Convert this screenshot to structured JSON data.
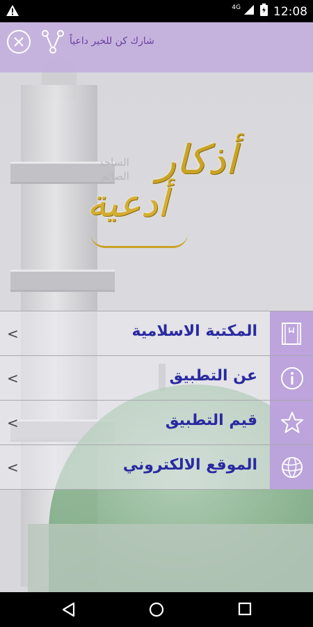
{
  "status_bar": {
    "network": "4G",
    "time": "12:08"
  },
  "header": {
    "share_text": "شارك كن للخير داعياً"
  },
  "logo": {
    "title_top": "أذكار",
    "title_bottom": "أدعية",
    "subtitle_line1": "الساجد",
    "subtitle_line2": "الصائم"
  },
  "menu": {
    "items": [
      {
        "label": "المكتبة الاسلامية",
        "icon": "book-icon"
      },
      {
        "label": "عن التطبيق",
        "icon": "info-icon"
      },
      {
        "label": "قيم التطبيق",
        "icon": "star-icon"
      },
      {
        "label": "الموقع الالكتروني",
        "icon": "globe-icon"
      }
    ]
  },
  "colors": {
    "header_bg": "#c4b0dc",
    "icon_box_bg": "#baa0dc",
    "menu_text": "#2a2aa0",
    "logo_gold": "#c9a227"
  }
}
